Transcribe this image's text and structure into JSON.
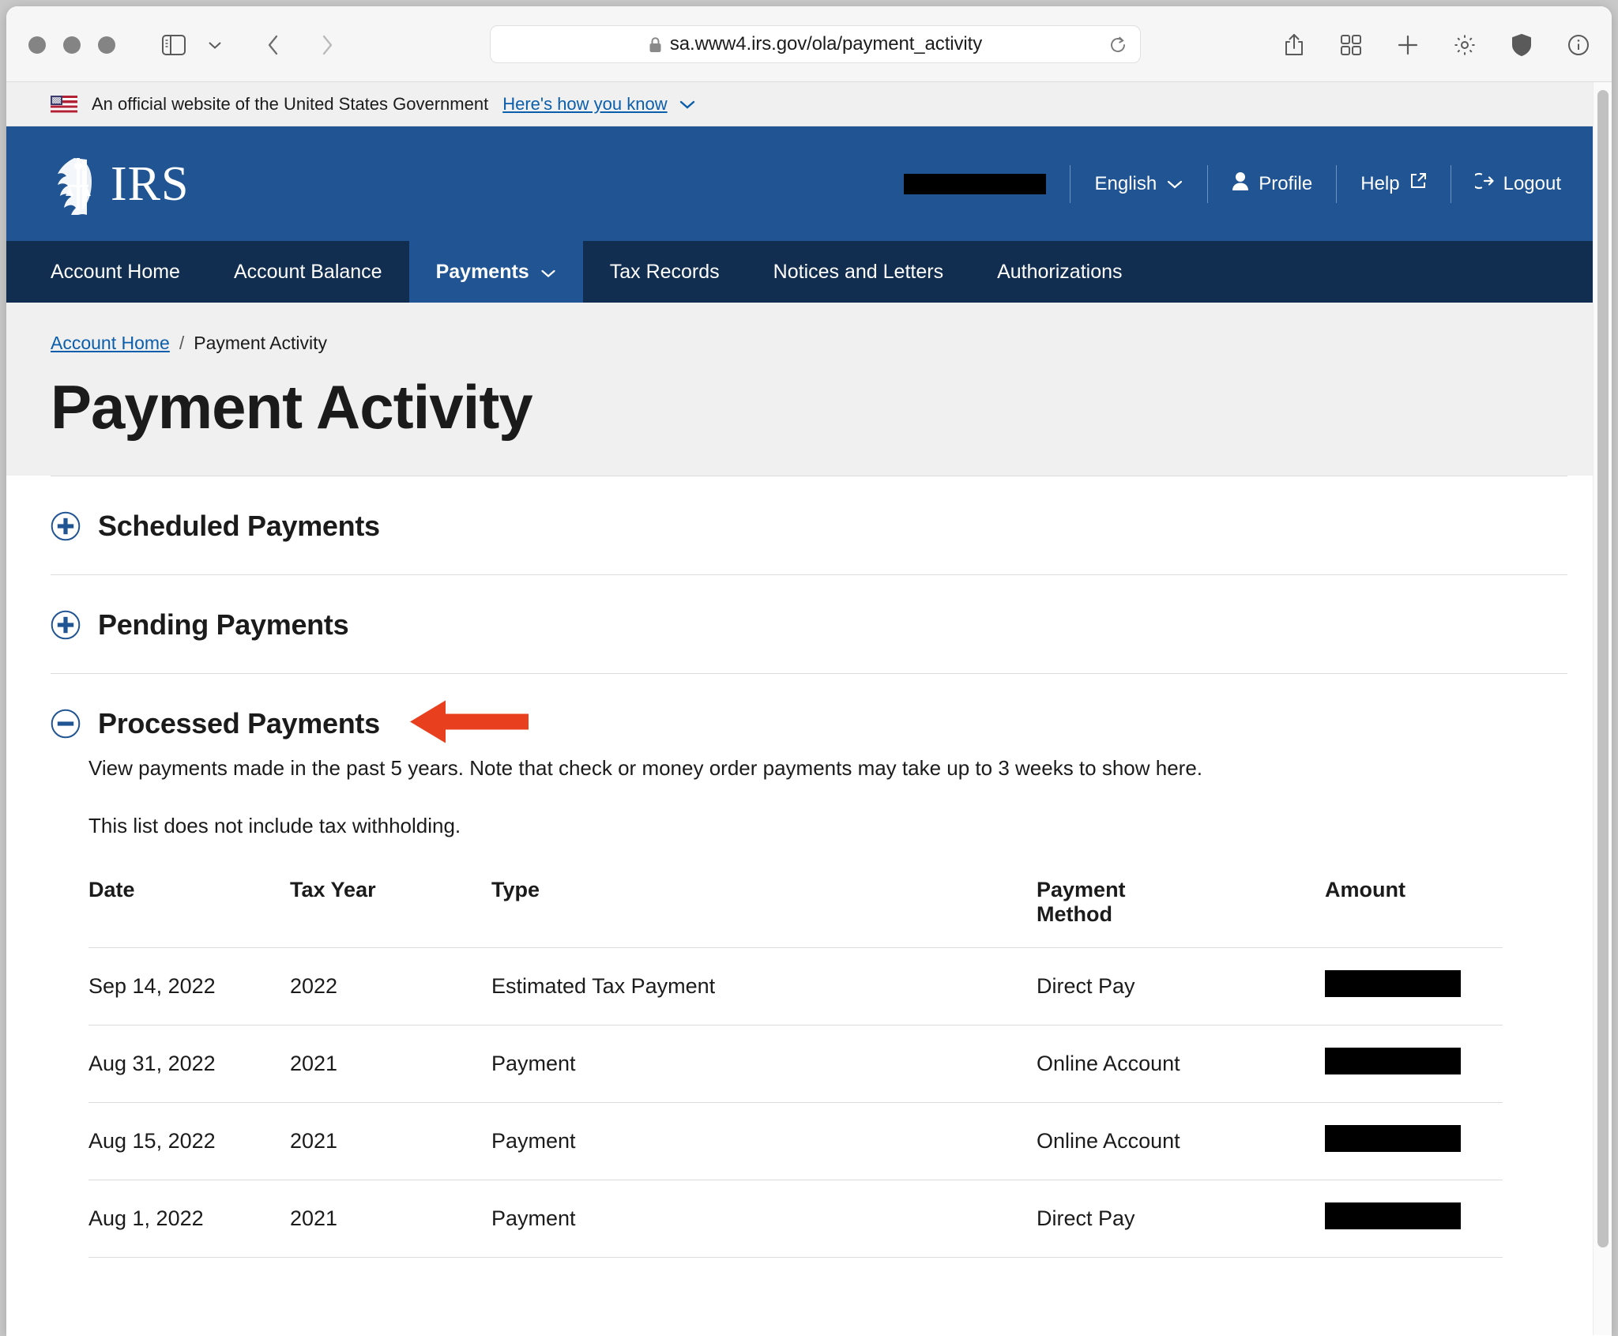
{
  "browser": {
    "url": "sa.www4.irs.gov/ola/payment_activity",
    "lock_icon": "lock-icon",
    "reload_icon": "reload-icon",
    "sidebar_icon": "sidebar-toggle-icon",
    "sidebar_chevron_icon": "chevron-down-icon",
    "back_icon": "chevron-left-icon",
    "forward_icon": "chevron-right-icon",
    "right_icons": [
      {
        "name": "share-icon"
      },
      {
        "name": "tab-overview-icon"
      },
      {
        "name": "new-tab-icon"
      },
      {
        "name": "gear-icon"
      },
      {
        "name": "shield-icon"
      },
      {
        "name": "info-icon"
      }
    ]
  },
  "gov_banner": {
    "flag_icon": "us-flag-icon",
    "text": "An official website of the United States Government",
    "link": "Here's how you know",
    "chevron_icon": "chevron-down-icon"
  },
  "header": {
    "logo_text": "IRS",
    "logo_icon": "irs-eagle-scales-icon",
    "user_name_redacted": "",
    "language": "English",
    "language_chevron_icon": "chevron-down-icon",
    "profile": "Profile",
    "profile_icon": "user-icon",
    "help": "Help",
    "help_icon": "external-link-icon",
    "logout": "Logout",
    "logout_icon": "logout-icon"
  },
  "nav": {
    "items": [
      {
        "label": "Account Home",
        "active": false,
        "has_chevron": false
      },
      {
        "label": "Account Balance",
        "active": false,
        "has_chevron": false
      },
      {
        "label": "Payments",
        "active": true,
        "has_chevron": true
      },
      {
        "label": "Tax Records",
        "active": false,
        "has_chevron": false
      },
      {
        "label": "Notices and Letters",
        "active": false,
        "has_chevron": false
      },
      {
        "label": "Authorizations",
        "active": false,
        "has_chevron": false
      }
    ]
  },
  "breadcrumb": {
    "home": "Account Home",
    "separator": "/",
    "current": "Payment Activity"
  },
  "page": {
    "title": "Payment Activity"
  },
  "accordions": [
    {
      "title": "Scheduled Payments",
      "icon": "plus-circle-icon",
      "expanded": false
    },
    {
      "title": "Pending Payments",
      "icon": "plus-circle-icon",
      "expanded": false
    },
    {
      "title": "Processed Payments",
      "icon": "minus-circle-icon",
      "expanded": true
    }
  ],
  "processed": {
    "intro_line_1": "View payments made in the past 5 years. Note that check or money order payments may take up to 3 weeks to show here.",
    "intro_line_2": "This list does not include tax withholding.",
    "columns": [
      "Date",
      "Tax Year",
      "Type",
      "Payment Method",
      "Amount"
    ],
    "column_payment_method_line1": "Payment",
    "column_payment_method_line2": "Method",
    "rows": [
      {
        "date": "Sep 14, 2022",
        "tax_year": "2022",
        "type": "Estimated Tax Payment",
        "method": "Direct Pay",
        "amount": ""
      },
      {
        "date": "Aug 31, 2022",
        "tax_year": "2021",
        "type": "Payment",
        "method": "Online Account",
        "amount": ""
      },
      {
        "date": "Aug 15, 2022",
        "tax_year": "2021",
        "type": "Payment",
        "method": "Online Account",
        "amount": ""
      },
      {
        "date": "Aug 1, 2022",
        "tax_year": "2021",
        "type": "Payment",
        "method": "Direct Pay",
        "amount": ""
      }
    ]
  },
  "annotation": {
    "arrow_icon": "red-left-arrow-annotation",
    "color": "#e8401f",
    "points_at": "Processed Payments"
  },
  "colors": {
    "irs_blue": "#205493",
    "nav_navy": "#112e51",
    "link_blue": "#0b5eab",
    "hero_grey": "#f0f0f0",
    "annotation_red": "#e8401f"
  }
}
